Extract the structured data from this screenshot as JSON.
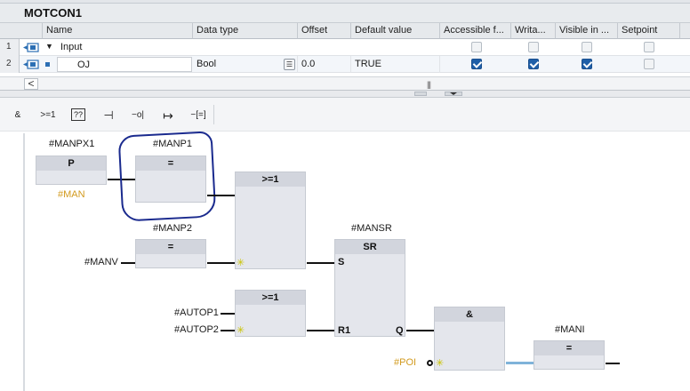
{
  "block": {
    "name": "MOTCON1"
  },
  "table": {
    "headers": [
      "Name",
      "Data type",
      "Offset",
      "Default value",
      "Accessible f...",
      "Writa...",
      "Visible in ...",
      "Setpoint"
    ],
    "rows": [
      {
        "num": "1",
        "name": "Input",
        "type": "",
        "offset": "",
        "default": "",
        "expand": "▼",
        "accessible": false,
        "writable": false,
        "visible": false,
        "setpoint": false
      },
      {
        "num": "2",
        "name": "OJ",
        "type": "Bool",
        "offset": "0.0",
        "default": "TRUE",
        "accessible": true,
        "writable": true,
        "visible": true,
        "setpoint": false
      }
    ],
    "scroll_left": "<",
    "scroll_grip": "|||"
  },
  "toolbar": {
    "and": "&",
    "or": ">=1",
    "empty_box": "??",
    "nc_contact": "⊣",
    "negation": "−o|",
    "branch": "↦",
    "assignment": "−[=]"
  },
  "network": {
    "p_block": {
      "instance": "#MANPX1",
      "title": "P",
      "input": "#MAN"
    },
    "assign1": {
      "instance": "#MANP1",
      "title": "="
    },
    "assign2": {
      "instance": "#MANP2",
      "title": "=",
      "input": "#MANV"
    },
    "or1": {
      "title": ">=1"
    },
    "or2": {
      "title": ">=1",
      "input1": "#AUTOP1",
      "input2": "#AUTOP2"
    },
    "sr": {
      "instance": "#MANSR",
      "title": "SR",
      "pin_s": "S",
      "pin_r1": "R1",
      "pin_q": "Q"
    },
    "and_block": {
      "title": "&",
      "input": "#POI"
    },
    "assign3": {
      "instance": "#MANI",
      "title": "="
    }
  },
  "colors": {
    "accent_blue": "#1f5fa8",
    "annotation_circle": "#1a2a8e",
    "operand_orange": "#d29a1e",
    "block_body": "#e4e6ec",
    "block_header": "#d2d5dd"
  }
}
